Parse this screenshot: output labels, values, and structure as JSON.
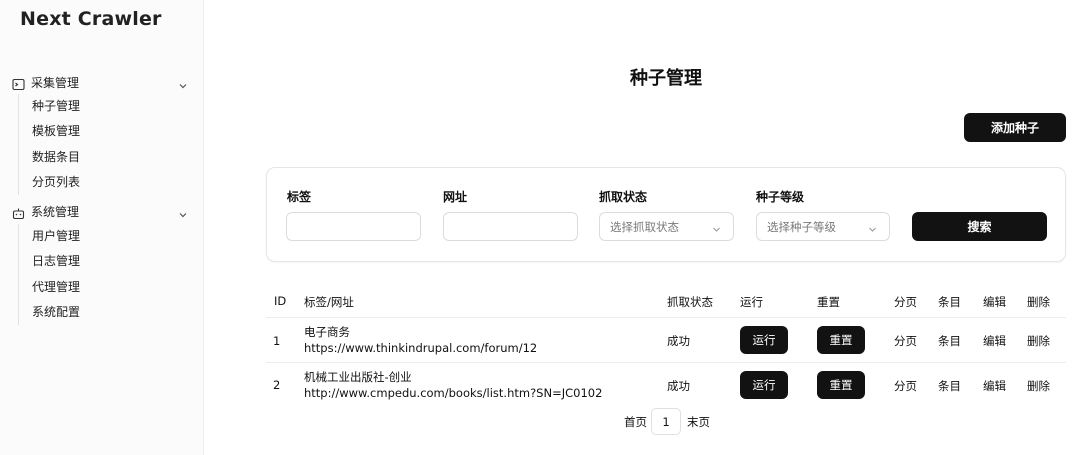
{
  "app": {
    "brand": "Next Crawler"
  },
  "sidebar": {
    "groups": [
      {
        "label": "采集管理",
        "icon": "terminal-icon",
        "items": [
          "种子管理",
          "模板管理",
          "数据条目",
          "分页列表"
        ]
      },
      {
        "label": "系统管理",
        "icon": "robot-icon",
        "items": [
          "用户管理",
          "日志管理",
          "代理管理",
          "系统配置"
        ]
      }
    ]
  },
  "page": {
    "title": "种子管理",
    "add_button": "添加种子"
  },
  "filters": {
    "tag_label": "标签",
    "url_label": "网址",
    "status_label": "抓取状态",
    "status_placeholder": "选择抓取状态",
    "level_label": "种子等级",
    "level_placeholder": "选择种子等级",
    "search_button": "搜索"
  },
  "table": {
    "columns": [
      "ID",
      "标签/网址",
      "抓取状态",
      "运行",
      "重置",
      "分页",
      "条目",
      "编辑",
      "删除"
    ],
    "rows": [
      {
        "id": "1",
        "tag": "电子商务",
        "url": "https://www.thinkindrupal.com/forum/12",
        "status": "成功",
        "run": "运行",
        "reset": "重置",
        "pages": "分页",
        "entries": "条目",
        "edit": "编辑",
        "delete": "删除"
      },
      {
        "id": "2",
        "tag": "机械工业出版社-创业",
        "url": "http://www.cmpedu.com/books/list.htm?SN=JC0102",
        "status": "成功",
        "run": "运行",
        "reset": "重置",
        "pages": "分页",
        "entries": "条目",
        "edit": "编辑",
        "delete": "删除"
      }
    ]
  },
  "pagination": {
    "first": "首页",
    "current": "1",
    "last": "末页"
  }
}
